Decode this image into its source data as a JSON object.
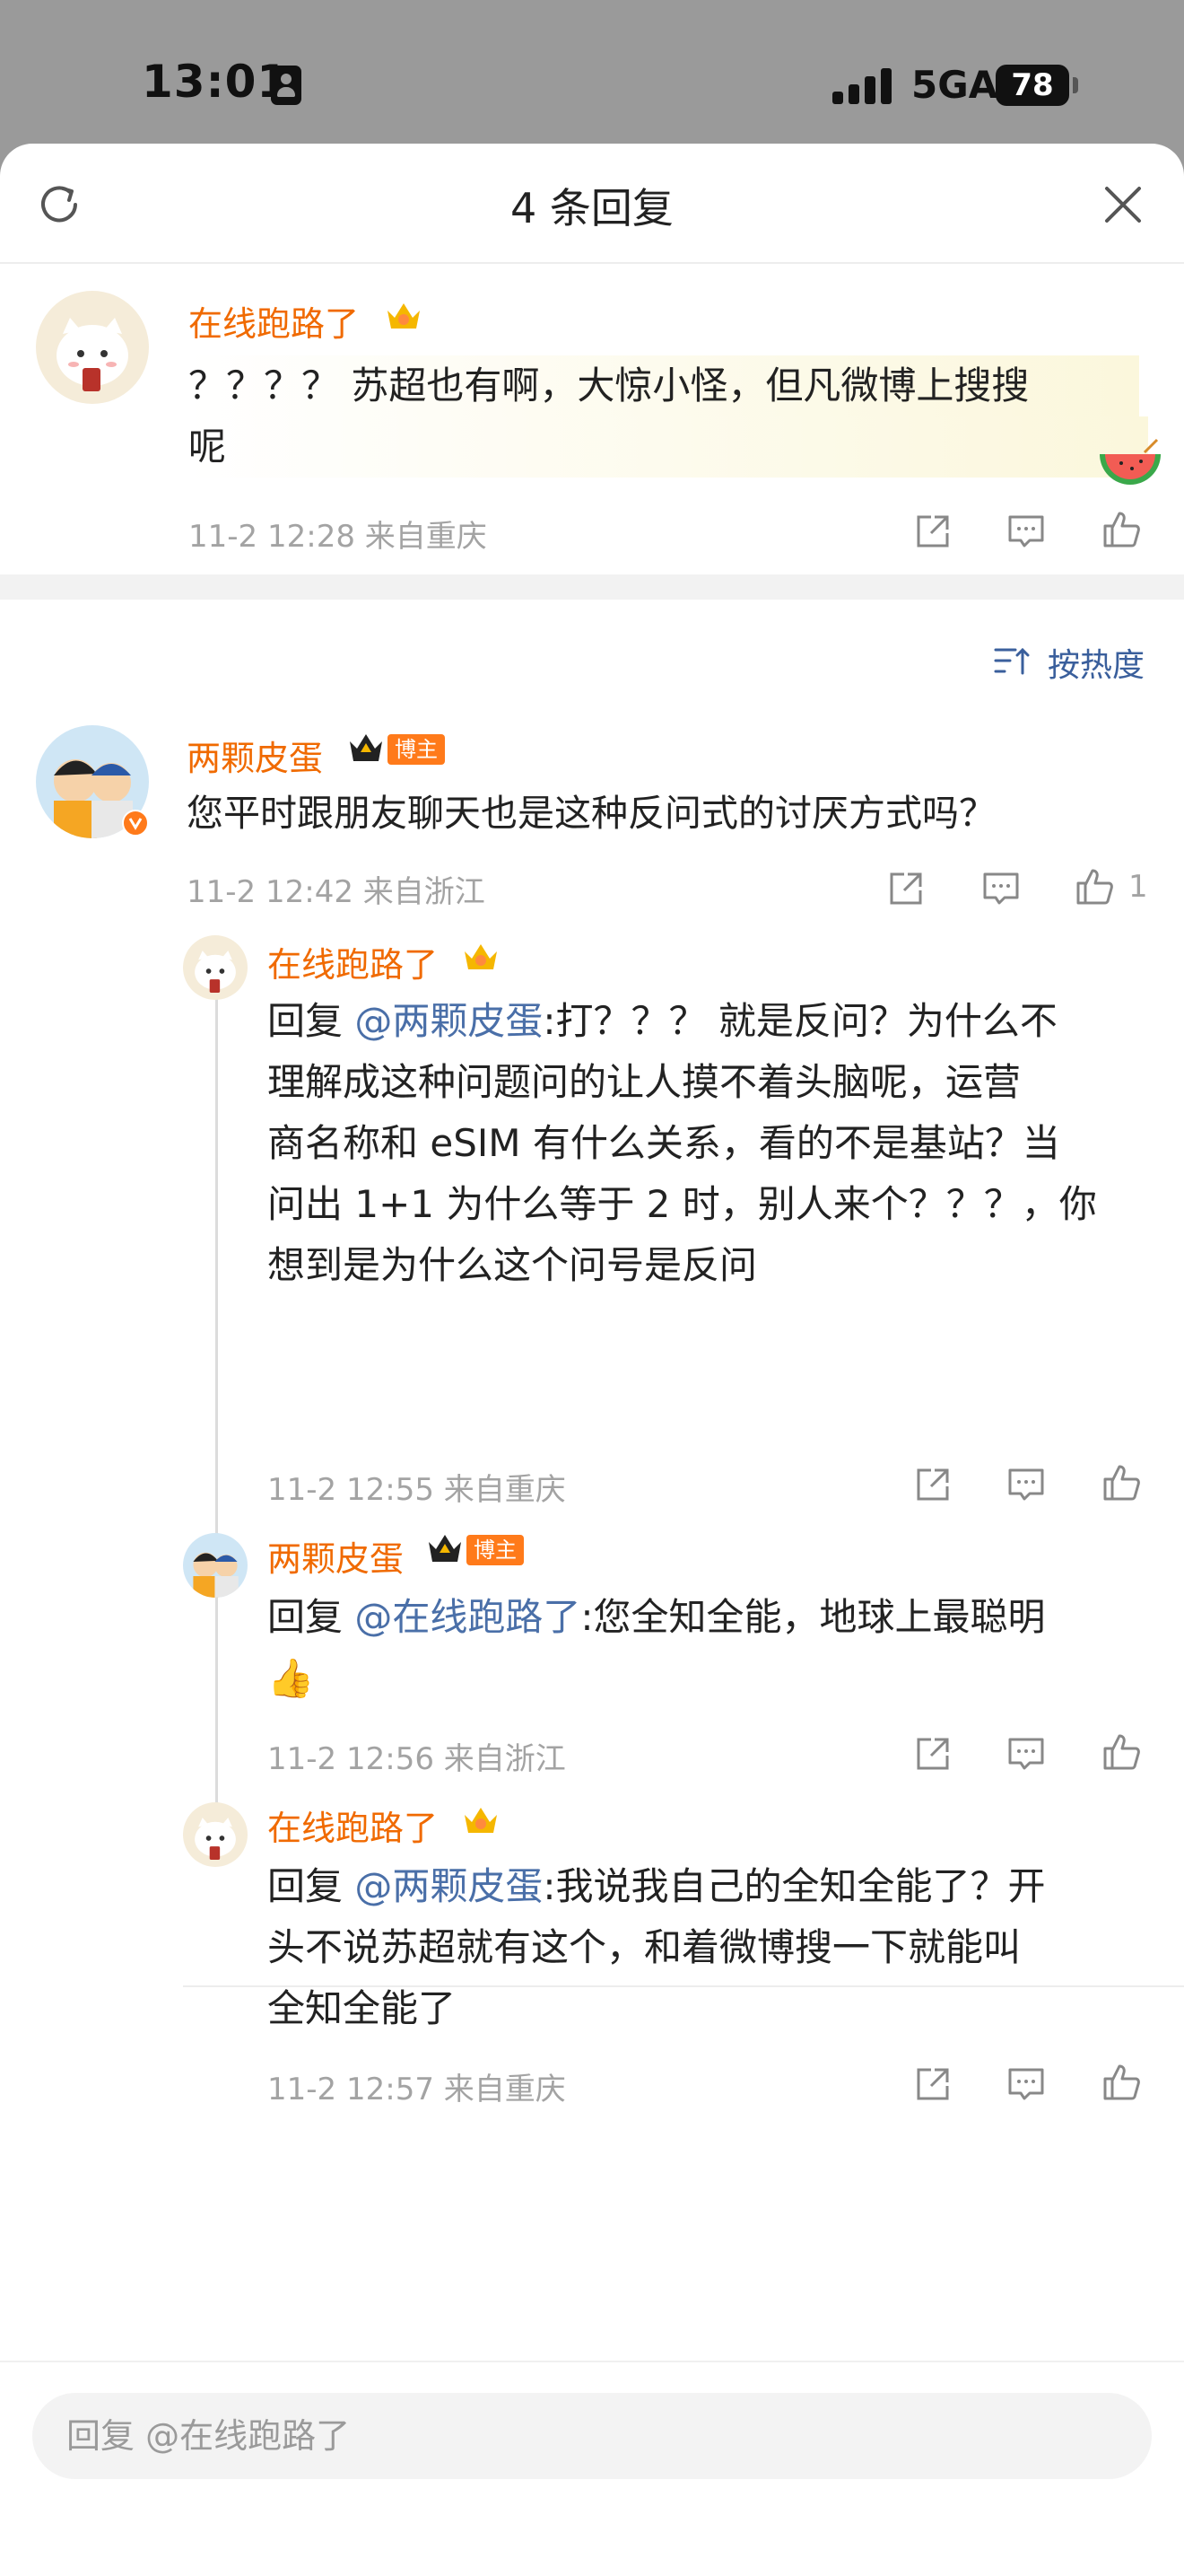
{
  "status_bar": {
    "time": "13:01",
    "network": "5GA",
    "battery": "78"
  },
  "header": {
    "title": "4 条回复"
  },
  "root_comment": {
    "author": "在线跑路了",
    "text_line1": "？？？？ 苏超也有啊，大惊小怪，但凡微博上搜搜",
    "text_line2": "呢",
    "meta": "11-2 12:28  来自重庆"
  },
  "sort": {
    "label": "按热度"
  },
  "replies": [
    {
      "author": "两颗皮蛋",
      "badge": "博主",
      "text": "您平时跟朋友聊天也是这种反问式的讨厌方式吗？",
      "meta": "11-2 12:42  来自浙江",
      "like_count": "1"
    },
    {
      "author": "在线跑路了",
      "reply_prefix": "回复 ",
      "mention": "@两颗皮蛋",
      "lines": [
        ":打？？？ 就是反问？为什么不",
        "理解成这种问题问的让人摸不着头脑呢，运营",
        "商名称和 eSIM 有什么关系，看的不是基站？当",
        "问出 1+1 为什么等于 2 时，别人来个？？？，你",
        "想到是为什么这个问号是反问"
      ],
      "meta": "11-2 12:55  来自重庆"
    },
    {
      "author": "两颗皮蛋",
      "badge": "博主",
      "reply_prefix": "回复 ",
      "mention": "@在线跑路了",
      "line1": ":您全知全能，地球上最聪明",
      "emoji": "👍",
      "meta": "11-2 12:56  来自浙江"
    },
    {
      "author": "在线跑路了",
      "reply_prefix": "回复 ",
      "mention": "@两颗皮蛋",
      "lines": [
        ":我说我自己的全知全能了？开",
        "头不说苏超就有这个，和着微博搜一下就能叫",
        "全知全能了"
      ],
      "meta": "11-2 12:57  来自重庆"
    }
  ],
  "reply_input": {
    "placeholder": "回复 @在线跑路了"
  },
  "colors": {
    "name": "#f06a00",
    "mention": "#4a6fa8",
    "meta": "#a3a3a3"
  },
  "icons": [
    "refresh-icon",
    "close-icon",
    "share-icon",
    "comment-icon",
    "like-icon",
    "crown-icon",
    "sort-icon"
  ]
}
